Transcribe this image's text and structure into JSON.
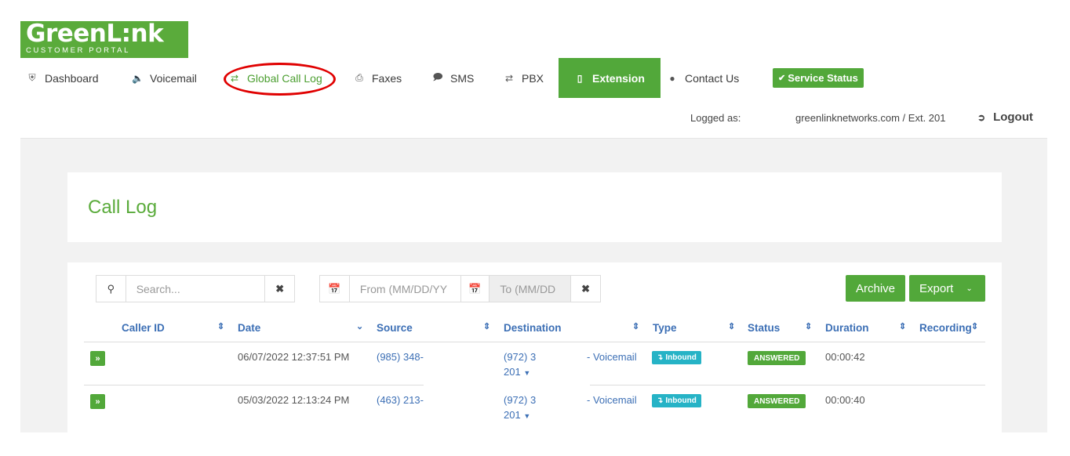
{
  "logo": {
    "word": "GreenL:nk",
    "tagline": "CUSTOMER PORTAL"
  },
  "nav": {
    "dashboard": "Dashboard",
    "voicemail": "Voicemail",
    "global_call_log": "Global Call Log",
    "faxes": "Faxes",
    "sms": "SMS",
    "pbx": "PBX",
    "extension": "Extension",
    "contact_us": "Contact Us",
    "service_status": "Service Status"
  },
  "session": {
    "logged_label": "Logged as:",
    "user": "greenlinknetworks.com / Ext. 201",
    "logout": "Logout"
  },
  "page": {
    "title": "Call Log"
  },
  "toolbar": {
    "search_placeholder": "Search...",
    "from_placeholder": "From (MM/DD/YY",
    "to_placeholder": "To (MM/DD",
    "archive": "Archive",
    "export": "Export"
  },
  "table": {
    "columns": [
      "Caller ID",
      "Date",
      "Source",
      "Destination",
      "Type",
      "Status",
      "Duration",
      "Recording"
    ],
    "rows": [
      {
        "caller_id": "",
        "date": "06/07/2022 12:37:51 PM",
        "source": "(985) 348-",
        "destination": "(972) 3",
        "destination_ext": "201",
        "dest_label": "- Voicemail",
        "type": "Inbound",
        "status": "ANSWERED",
        "duration": "00:00:42"
      },
      {
        "caller_id": "",
        "date": "05/03/2022 12:13:24 PM",
        "source": "(463) 213-",
        "destination": "(972) 3",
        "destination_ext": "201",
        "dest_label": "- Voicemail",
        "type": "Inbound",
        "status": "ANSWERED",
        "duration": "00:00:40"
      }
    ]
  },
  "colors": {
    "brand_green": "#52a83a",
    "link_blue": "#3c6fb5",
    "inbound_cyan": "#26b3c6",
    "highlight_red": "#e00000"
  }
}
